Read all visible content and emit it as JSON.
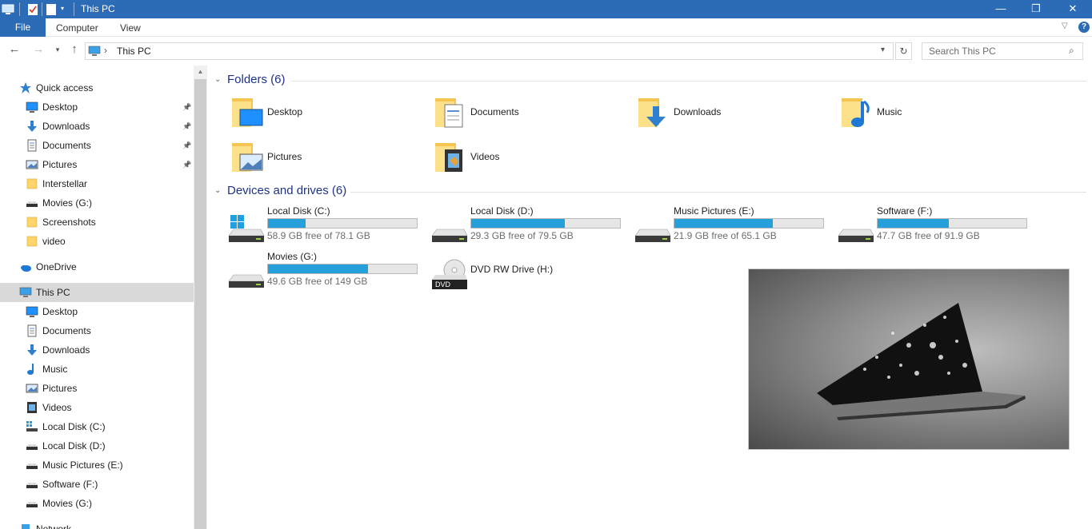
{
  "window": {
    "title": "This PC"
  },
  "window_controls": {
    "minimize": "—",
    "restore": "❐",
    "close": "✕"
  },
  "ribbon": {
    "file": "File",
    "tabs": [
      "Computer",
      "View"
    ]
  },
  "address": {
    "path": "This PC",
    "separator": "›"
  },
  "search": {
    "placeholder": "Search This PC"
  },
  "sidebar": {
    "quick_access": "Quick access",
    "quick_items": [
      {
        "label": "Desktop",
        "icon": "desktop-icon",
        "pinned": true
      },
      {
        "label": "Downloads",
        "icon": "downloads-icon",
        "pinned": true
      },
      {
        "label": "Documents",
        "icon": "documents-icon",
        "pinned": true
      },
      {
        "label": "Pictures",
        "icon": "pictures-icon",
        "pinned": true
      },
      {
        "label": "Interstellar",
        "icon": "folder-icon",
        "pinned": false
      },
      {
        "label": "Movies (G:)",
        "icon": "drive-icon",
        "pinned": false
      },
      {
        "label": "Screenshots",
        "icon": "folder-icon",
        "pinned": false
      },
      {
        "label": "video",
        "icon": "folder-icon",
        "pinned": false
      }
    ],
    "onedrive": "OneDrive",
    "this_pc": "This PC",
    "pc_items": [
      {
        "label": "Desktop",
        "icon": "desktop-icon"
      },
      {
        "label": "Documents",
        "icon": "documents-icon"
      },
      {
        "label": "Downloads",
        "icon": "downloads-icon"
      },
      {
        "label": "Music",
        "icon": "music-icon"
      },
      {
        "label": "Pictures",
        "icon": "pictures-icon"
      },
      {
        "label": "Videos",
        "icon": "videos-icon"
      },
      {
        "label": "Local Disk (C:)",
        "icon": "windows-drive-icon"
      },
      {
        "label": "Local Disk (D:)",
        "icon": "drive-icon"
      },
      {
        "label": "Music Pictures (E:)",
        "icon": "drive-icon"
      },
      {
        "label": "Software (F:)",
        "icon": "drive-icon"
      },
      {
        "label": "Movies (G:)",
        "icon": "drive-icon"
      }
    ],
    "network": "Network"
  },
  "folders_group": {
    "title": "Folders (6)",
    "items": [
      {
        "label": "Desktop",
        "icon": "desktop-folder-icon"
      },
      {
        "label": "Documents",
        "icon": "documents-folder-icon"
      },
      {
        "label": "Downloads",
        "icon": "downloads-folder-icon"
      },
      {
        "label": "Music",
        "icon": "music-folder-icon"
      },
      {
        "label": "Pictures",
        "icon": "pictures-folder-icon"
      },
      {
        "label": "Videos",
        "icon": "videos-folder-icon"
      }
    ]
  },
  "drives_group": {
    "title": "Devices and drives (6)",
    "items": [
      {
        "label": "Local Disk (C:)",
        "free": "58.9 GB free of 78.1 GB",
        "used_fraction": 0.25,
        "icon": "windows-drive-icon"
      },
      {
        "label": "Local Disk (D:)",
        "free": "29.3 GB free of 79.5 GB",
        "used_fraction": 0.63,
        "icon": "drive-icon"
      },
      {
        "label": "Music Pictures (E:)",
        "free": "21.9 GB free of 65.1 GB",
        "used_fraction": 0.66,
        "icon": "drive-icon"
      },
      {
        "label": "Software (F:)",
        "free": "47.7 GB free of 91.9 GB",
        "used_fraction": 0.48,
        "icon": "drive-icon"
      },
      {
        "label": "Movies (G:)",
        "free": "49.6 GB free of 149 GB",
        "used_fraction": 0.67,
        "icon": "drive-icon"
      },
      {
        "label": "DVD RW Drive (H:)",
        "free": "",
        "used_fraction": null,
        "icon": "dvd-drive-icon",
        "badge": "DVD"
      }
    ]
  },
  "colors": {
    "accent": "#2c6bb5",
    "bar_fill": "#26a0da",
    "selection": "#d9d9d9",
    "group_title": "#1e3287"
  }
}
